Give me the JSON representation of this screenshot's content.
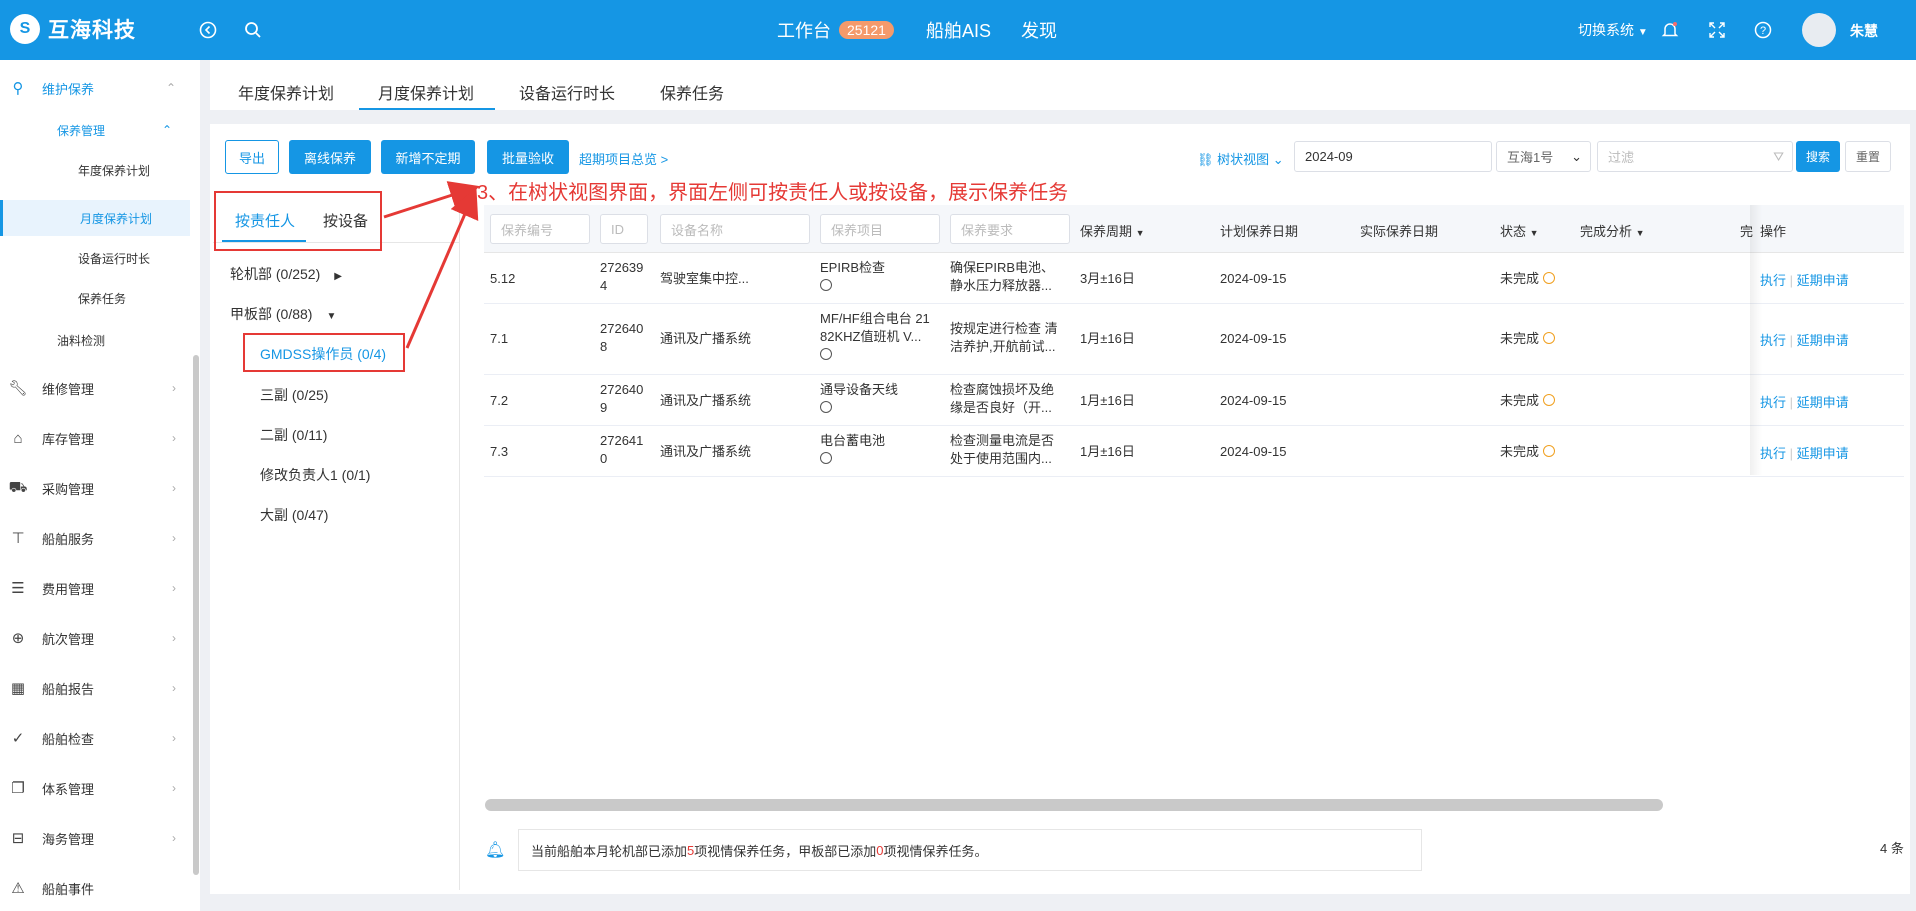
{
  "header": {
    "logo_text": "互海科技",
    "logo_mark": "S",
    "nav": [
      {
        "label": "工作台",
        "badge": "25121"
      },
      {
        "label": "船舶AIS"
      },
      {
        "label": "发现"
      }
    ],
    "switch_system": "切换系统",
    "user": "朱慧"
  },
  "sidebar": {
    "group": "维护保养",
    "sub_group": "保养管理",
    "sub_items": [
      "年度保养计划",
      "月度保养计划",
      "设备运行时长",
      "保养任务"
    ],
    "oil": "油料检测",
    "items": [
      {
        "icon": "wrench-icon",
        "label": "维修管理"
      },
      {
        "icon": "warehouse-icon",
        "label": "库存管理"
      },
      {
        "icon": "cart-icon",
        "label": "采购管理"
      },
      {
        "icon": "paint-roller-icon",
        "label": "船舶服务"
      },
      {
        "icon": "coins-icon",
        "label": "费用管理"
      },
      {
        "icon": "globe-icon",
        "label": "航次管理"
      },
      {
        "icon": "calendar-icon",
        "label": "船舶报告"
      },
      {
        "icon": "check-circle-icon",
        "label": "船舶检查"
      },
      {
        "icon": "documents-icon",
        "label": "体系管理"
      },
      {
        "icon": "signpost-icon",
        "label": "海务管理"
      },
      {
        "icon": "warning-icon",
        "label": "船舶事件"
      }
    ]
  },
  "tabs": [
    "年度保养计划",
    "月度保养计划",
    "设备运行时长",
    "保养任务"
  ],
  "toolbar": {
    "export": "导出",
    "offline": "离线保养",
    "add_irregular": "新增不定期",
    "batch_accept": "批量验收",
    "overdue_link": "超期项目总览 >",
    "tree_view": "树状视图",
    "date": "2024-09",
    "ship": "互海1号",
    "filter_placeholder": "过滤",
    "search": "搜索",
    "reset": "重置"
  },
  "annotation": "3、在树状视图界面，界面左侧可按责任人或按设备，展示保养任务",
  "tree": {
    "tab_person": "按责任人",
    "tab_device": "按设备",
    "nodes": [
      {
        "label": "轮机部 (0/252)",
        "level": 0
      },
      {
        "label": "甲板部 (0/88)",
        "level": 0
      },
      {
        "label": "GMDSS操作员 (0/4)",
        "level": 1
      },
      {
        "label": "三副 (0/25)",
        "level": 1
      },
      {
        "label": "二副 (0/11)",
        "level": 1
      },
      {
        "label": "修改负责人1 (0/1)",
        "level": 1
      },
      {
        "label": "大副 (0/47)",
        "level": 1
      }
    ]
  },
  "table": {
    "filters": {
      "code": "保养编号",
      "id": "ID",
      "device": "设备名称",
      "item": "保养项目",
      "req": "保养要求"
    },
    "headers": {
      "cycle": "保养周期",
      "plan_date": "计划保养日期",
      "actual_date": "实际保养日期",
      "status": "状态",
      "analysis": "完成分析",
      "done": "完",
      "ops": "操作"
    },
    "rows": [
      {
        "code": "5.12",
        "id": [
          "272639",
          "4"
        ],
        "device": "驾驶室集中控...",
        "item": [
          "EPIRB检查"
        ],
        "req": [
          "确保EPIRB电池、",
          "静水压力释放器..."
        ],
        "cycle": "3月±16日",
        "plan": "2024-09-15",
        "status": "未完成"
      },
      {
        "code": "7.1",
        "id": [
          "272640",
          "8"
        ],
        "device": "通讯及广播系统",
        "item": [
          "MF/HF组合电台 21",
          "82KHZ值班机 V..."
        ],
        "req": [
          "按规定进行检查 清",
          "洁养护,开航前试..."
        ],
        "cycle": "1月±16日",
        "plan": "2024-09-15",
        "status": "未完成"
      },
      {
        "code": "7.2",
        "id": [
          "272640",
          "9"
        ],
        "device": "通讯及广播系统",
        "item": [
          "通导设备天线"
        ],
        "req": [
          "检查腐蚀损坏及绝",
          "缘是否良好（开..."
        ],
        "cycle": "1月±16日",
        "plan": "2024-09-15",
        "status": "未完成"
      },
      {
        "code": "7.3",
        "id": [
          "272641",
          "0"
        ],
        "device": "通讯及广播系统",
        "item": [
          "电台蓄电池"
        ],
        "req": [
          "检查测量电流是否",
          "处于使用范围内..."
        ],
        "cycle": "1月±16日",
        "plan": "2024-09-15",
        "status": "未完成"
      }
    ],
    "action_exec": "执行",
    "action_sep": "|",
    "action_delay": "延期申请"
  },
  "notice": {
    "pre": "当前船舶本月轮机部已添加 ",
    "n1": "5",
    "mid": " 项视情保养任务，甲板部已添加 ",
    "n2": "0",
    "post": " 项视情保养任务。"
  },
  "total": "4 条"
}
